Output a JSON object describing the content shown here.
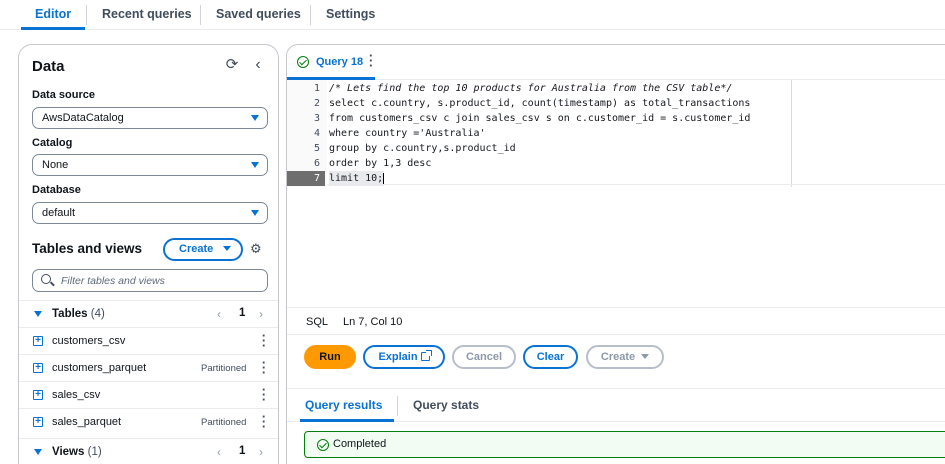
{
  "top_tabs": {
    "editor": "Editor",
    "recent": "Recent queries",
    "saved": "Saved queries",
    "settings": "Settings"
  },
  "data_panel": {
    "title": "Data",
    "refresh_icon": "refresh-icon",
    "collapse_icon": "chevron-left-icon",
    "data_source_label": "Data source",
    "data_source_value": "AwsDataCatalog",
    "catalog_label": "Catalog",
    "catalog_value": "None",
    "database_label": "Database",
    "database_value": "default",
    "tables_views_title": "Tables and views",
    "create_label": "Create",
    "filter_placeholder": "Filter tables and views"
  },
  "tables_group": {
    "label": "Tables",
    "count": "(4)",
    "page": "1",
    "items": [
      {
        "name": "customers_csv",
        "tag": ""
      },
      {
        "name": "customers_parquet",
        "tag": "Partitioned"
      },
      {
        "name": "sales_csv",
        "tag": ""
      },
      {
        "name": "sales_parquet",
        "tag": "Partitioned"
      }
    ]
  },
  "views_group": {
    "label": "Views",
    "count": "(1)",
    "page": "1"
  },
  "query_tab": {
    "name": "Query 18",
    "status_icon": "success-check-icon"
  },
  "code_lines": [
    {
      "n": "1",
      "text": "/* Lets find the top 10 products for Australia from the CSV table*/"
    },
    {
      "n": "2",
      "text": "select c.country, s.product_id, count(timestamp) as total_transactions"
    },
    {
      "n": "3",
      "text": "from customers_csv c join sales_csv s on c.customer_id = s.customer_id"
    },
    {
      "n": "4",
      "text": "where country ='Australia'"
    },
    {
      "n": "5",
      "text": "group by c.country,s.product_id"
    },
    {
      "n": "6",
      "text": "order by 1,3 desc"
    },
    {
      "n": "7",
      "text": "limit 10;"
    }
  ],
  "status_bar": {
    "language": "SQL",
    "position": "Ln 7, Col 10"
  },
  "actions": {
    "run": "Run",
    "explain": "Explain",
    "cancel": "Cancel",
    "clear": "Clear",
    "create": "Create"
  },
  "results_tabs": {
    "results": "Query results",
    "stats": "Query stats"
  },
  "result_status": "Completed",
  "colors": {
    "accent": "#0972d3",
    "run_button": "#ff9900",
    "success": "#037f0c"
  }
}
